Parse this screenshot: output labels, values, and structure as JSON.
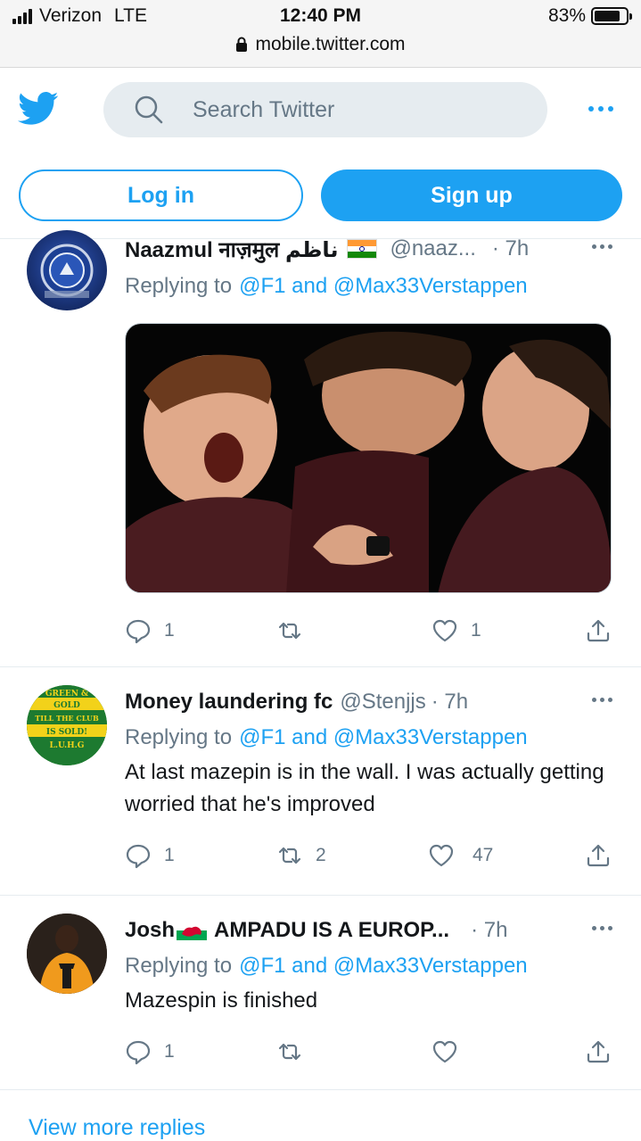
{
  "status_bar": {
    "carrier": "Verizon",
    "network": "LTE",
    "time": "12:40 PM",
    "battery": "83%",
    "battery_level": 0.83,
    "url": "mobile.twitter.com"
  },
  "header": {
    "search_placeholder": "Search Twitter",
    "login_label": "Log in",
    "signup_label": "Sign up",
    "accent": "#1da1f2"
  },
  "tweets": [
    {
      "name": "Naazmul नाज़मुल ناظم",
      "flag": "india-flag",
      "handle": "@naaz...",
      "time": "· 7h",
      "reply_prefix": "Replying to",
      "reply_mentions": "@F1 and @Max33Verstappen",
      "text": "",
      "has_image": true,
      "replies": "1",
      "retweets": "",
      "likes": "1"
    },
    {
      "name": "Money laundering fc",
      "handle": "@Stenjjs",
      "time": "· 7h",
      "reply_prefix": "Replying to",
      "reply_mentions": "@F1 and @Max33Verstappen",
      "text": "At last mazepin is in the wall. I was actually getting worried that he's improved",
      "replies": "1",
      "retweets": "2",
      "likes": "47",
      "avatar_text": [
        "GREEN &",
        "GOLD",
        "TILL THE CLUB",
        "IS SOLD!",
        "L.U.H.G"
      ]
    },
    {
      "name_first": "Josh",
      "flag": "wales-flag",
      "name_rest": "AMPADU IS A EUROP...",
      "time": "· 7h",
      "reply_prefix": "Replying to",
      "reply_mentions": "@F1 and @Max33Verstappen",
      "text": "Mazespin is finished",
      "replies": "1",
      "retweets": "",
      "likes": ""
    }
  ],
  "footer": {
    "view_more": "View more replies"
  }
}
